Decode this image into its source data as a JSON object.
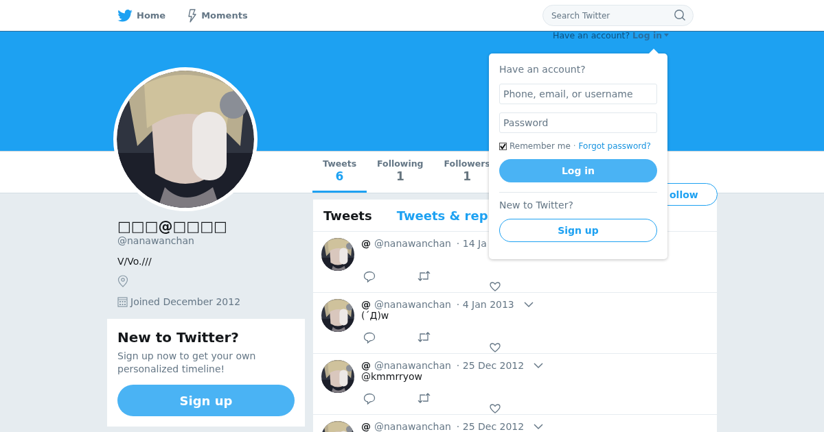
{
  "nav": {
    "items": [
      {
        "label": "Home"
      },
      {
        "label": "Moments"
      }
    ],
    "search": {
      "placeholder": "Search Twitter"
    }
  },
  "login_prompt": {
    "text": "Have an account?",
    "link": "Log in"
  },
  "login_popup": {
    "title": "Have an account?",
    "username": {
      "placeholder": "Phone, email, or username"
    },
    "password": {
      "placeholder": "Password"
    },
    "remember": {
      "label": "Remember me",
      "checked": true
    },
    "separator": "·",
    "forgot": "Forgot password?",
    "login_button": "Log in",
    "signup_title": "New to Twitter?",
    "signup_button": "Sign up"
  },
  "profile": {
    "name": "□□□@□□□□",
    "handle": "@nanawanchan",
    "bio": "V/Vo.///",
    "joined": "Joined December 2012"
  },
  "stats": [
    {
      "label": "Tweets",
      "value": "6",
      "selected": true
    },
    {
      "label": "Following",
      "value": "1",
      "selected": false
    },
    {
      "label": "Followers",
      "value": "1",
      "selected": false
    }
  ],
  "follow_button": "ollow",
  "signup_card": {
    "title": "New to Twitter?",
    "text": "Sign up now to get your own personalized timeline!",
    "button": "Sign up"
  },
  "timeline": {
    "tabs": [
      {
        "label": "Tweets",
        "selected": true
      },
      {
        "label": "Tweets & rep",
        "selected": false
      }
    ],
    "tweets": [
      {
        "name": "@",
        "handle": "@nanawanchan",
        "date": "· 14 Ja",
        "menu": false,
        "actions": true
      },
      {
        "name": "@",
        "handle": "@nanawanchan",
        "date": "· 4 Jan 2013",
        "text": "(´Д)w",
        "menu": true,
        "actions": true
      },
      {
        "name": "@",
        "handle": "@nanawanchan",
        "date": "· 25 Dec 2012",
        "text": "@kmmrryow",
        "menu": true,
        "actions": true
      },
      {
        "name": "@",
        "handle": "@nanawanchan",
        "date": "· 25 Dec 2012",
        "menu": true,
        "actions": false
      }
    ]
  }
}
